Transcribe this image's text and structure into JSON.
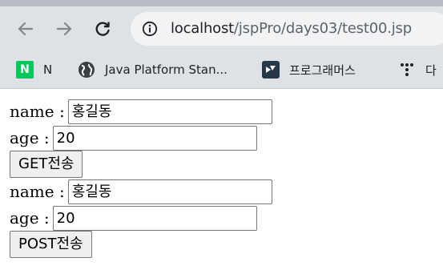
{
  "browser": {
    "url_host": "localhost",
    "url_path": "/jspPro/days03/test00.jsp",
    "bookmarks": [
      {
        "label": "N",
        "icon": "naver-icon"
      },
      {
        "label": "Java Platform Stan...",
        "icon": "globe-icon"
      },
      {
        "label": "프로그래머스",
        "icon": "programmers-icon"
      },
      {
        "label": "다",
        "icon": "dots-icon"
      }
    ]
  },
  "forms": [
    {
      "name_label": "name :",
      "name_value": "홍길동",
      "age_label": "age :",
      "age_value": "20",
      "submit_label": "GET전송"
    },
    {
      "name_label": "name :",
      "name_value": "홍길동",
      "age_label": "age :",
      "age_value": "20",
      "submit_label": "POST전송"
    }
  ],
  "colors": {
    "toolbar_bg": "#dee1e6",
    "omnibox_bg": "#f1f3f4",
    "naver_green": "#03c75a"
  }
}
